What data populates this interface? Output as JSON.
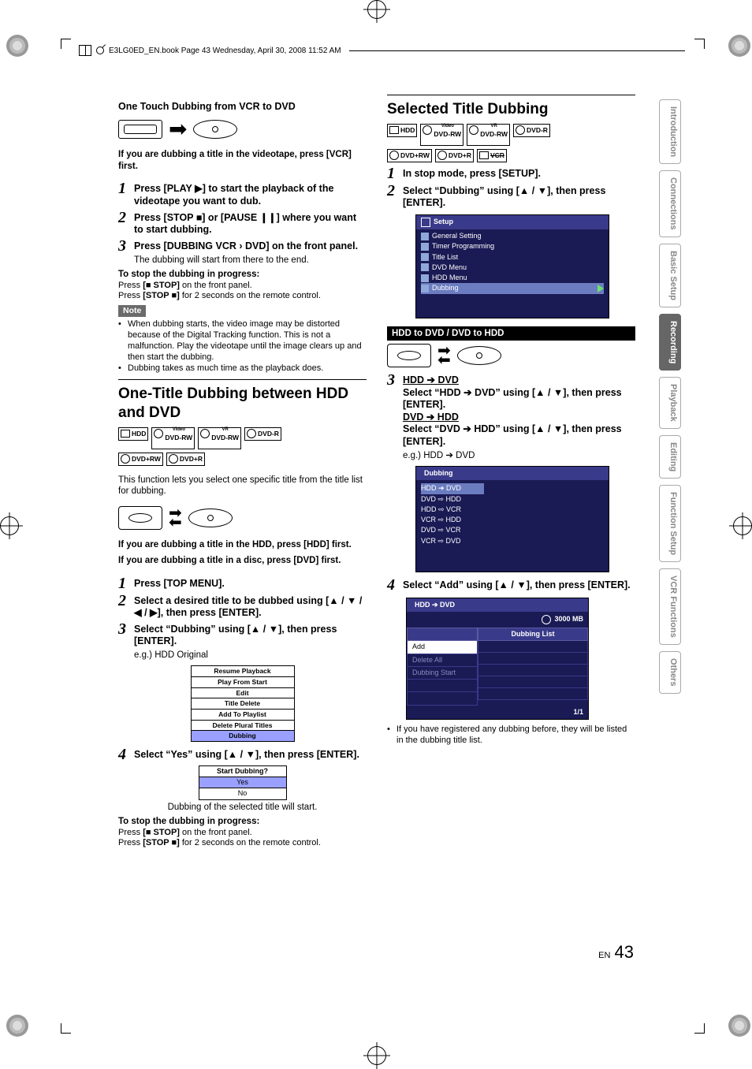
{
  "header": {
    "text": "E3LG0ED_EN.book  Page 43  Wednesday, April 30, 2008  11:52 AM"
  },
  "footer": {
    "lang": "EN",
    "page": "43"
  },
  "sidebar": {
    "tabs": [
      "Introduction",
      "Connections",
      "Basic Setup",
      "Recording",
      "Playback",
      "Editing",
      "Function Setup",
      "VCR Functions",
      "Others"
    ],
    "active_index": 3
  },
  "left": {
    "subhead1": "One Touch Dubbing from VCR to DVD",
    "intro1": "If you are dubbing a title in the videotape, press [VCR] first.",
    "s1": "Press [PLAY ▶] to start the playback of the videotape you want to dub.",
    "s2": "Press [STOP ■] or [PAUSE ❙❙] where you want to start dubbing.",
    "s3": "Press [DUBBING VCR › DVD] on the front panel.",
    "s3_sub": "The dubbing will start from there to the end.",
    "stop_hdr": "To stop the dubbing in progress:",
    "stop_l1": "Press [■ STOP] on the front panel.",
    "stop_l2": "Press [STOP ■] for 2 seconds on the remote control.",
    "note_label": "Note",
    "note_b1": "When dubbing starts, the video image may be distorted because of the Digital Tracking function. This is not a malfunction. Play the videotape until the image clears up and then start the dubbing.",
    "note_b2": "Dubbing takes as much time as the playback does.",
    "section2": "One-Title Dubbing between HDD and DVD",
    "media1": [
      "HDD",
      "DVD-RW",
      "DVD-RW",
      "DVD-R",
      "DVD+RW",
      "DVD+R"
    ],
    "media1_sup": [
      "",
      "Video",
      "VR",
      "",
      "",
      ""
    ],
    "desc2": "This function lets you select one specific title from the title list for dubbing.",
    "intro2a": "If you are dubbing a title in the HDD, press [HDD] first.",
    "intro2b": "If you are dubbing a title in a disc, press [DVD] first.",
    "t1": "Press [TOP MENU].",
    "t2": "Select a desired title to be dubbed using [▲ / ▼ / ◀ / ▶], then press [ENTER].",
    "t3": "Select “Dubbing” using [▲ / ▼], then press [ENTER].",
    "eg1": "e.g.) HDD Original",
    "menu1": [
      "Resume Playback",
      "Play From Start",
      "Edit",
      "Title Delete",
      "Add To Playlist",
      "Delete Plural Titles",
      "Dubbing"
    ],
    "t4": "Select “Yes” using [▲ / ▼], then press [ENTER].",
    "dlg_title": "Start Dubbing?",
    "dlg_yes": "Yes",
    "dlg_no": "No",
    "t4_sub": "Dubbing of the selected title will start.",
    "stop2_hdr": "To stop the dubbing in progress:",
    "stop2_l1": "Press [■ STOP] on the front panel.",
    "stop2_l2": "Press [STOP ■] for 2 seconds on the remote control."
  },
  "right": {
    "section": "Selected Title Dubbing",
    "media": [
      "HDD",
      "DVD-RW",
      "DVD-RW",
      "DVD-R",
      "DVD+RW",
      "DVD+R",
      "VCR"
    ],
    "media_sup": [
      "",
      "Video",
      "VR",
      "",
      "",
      "",
      ""
    ],
    "s1": "In stop mode, press [SETUP].",
    "s2": "Select “Dubbing” using [▲ / ▼], then press [ENTER].",
    "osd1_title": "Setup",
    "osd1_items": [
      "General Setting",
      "Timer Programming",
      "Title List",
      "DVD Menu",
      "HDD Menu",
      "Dubbing"
    ],
    "blackbar": "HDD to DVD / DVD to HDD",
    "s3_h1": "HDD ➔ DVD",
    "s3_t1": "Select “HDD ➔ DVD” using [▲ / ▼], then press [ENTER].",
    "s3_h2": "DVD ➔ HDD",
    "s3_t2": "Select “DVD ➔ HDD” using [▲ / ▼], then press [ENTER].",
    "eg": "e.g.) HDD ➔ DVD",
    "osd2_title": "Dubbing",
    "osd2_items": [
      "HDD ➔ DVD",
      "DVD ⇨ HDD",
      "HDD ⇨ VCR",
      "VCR ⇨ HDD",
      "DVD ⇨ VCR",
      "VCR ⇨ DVD"
    ],
    "s4": "Select “Add” using [▲ / ▼], then press [ENTER].",
    "osd3_title": "HDD ➔ DVD",
    "osd3_size": "3000 MB",
    "osd3_list_hdr": "Dubbing List",
    "osd3_left": [
      "Add",
      "Delete All",
      "Dubbing Start"
    ],
    "osd3_footer": "1/1",
    "tail": "If you have registered any dubbing before, they will be listed in the dubbing title list."
  }
}
